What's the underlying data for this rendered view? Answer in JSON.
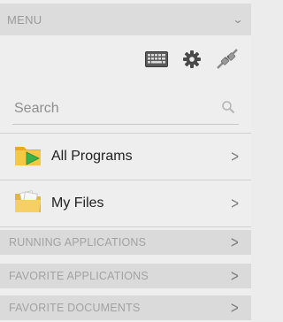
{
  "header": {
    "title": "MENU",
    "collapse_icon": "chevron-down-icon"
  },
  "toolbar": {
    "icons": [
      "keyboard-icon",
      "gear-icon",
      "plug-disconnect-icon"
    ]
  },
  "search": {
    "placeholder": "Search",
    "value": "",
    "icon": "search-icon"
  },
  "items": [
    {
      "label": "All Programs",
      "icon": "folder-play-icon",
      "arrow": ">"
    },
    {
      "label": "My Files",
      "icon": "folder-documents-icon",
      "arrow": ">"
    }
  ],
  "sections": [
    {
      "label": "RUNNING APPLICATIONS",
      "arrow": ">"
    },
    {
      "label": "FAVORITE APPLICATIONS",
      "arrow": ">"
    },
    {
      "label": "FAVORITE DOCUMENTS",
      "arrow": ">"
    }
  ],
  "colors": {
    "background": "#eeeeee",
    "header_bg": "#dcdcdc",
    "section_bg": "#dadada",
    "folder": "#f2c43a",
    "play": "#3bb24a"
  }
}
